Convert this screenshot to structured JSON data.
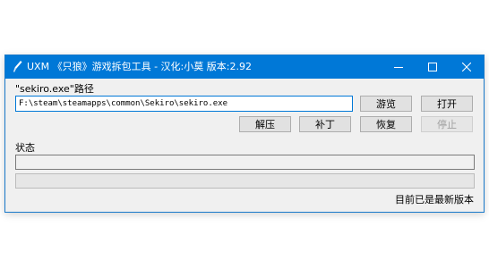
{
  "window": {
    "title": "UXM 《只狼》游戏拆包工具 - 汉化:小莫 版本:2.92"
  },
  "path_section": {
    "label": "\"sekiro.exe\"路径",
    "value": "F:\\steam\\steamapps\\common\\Sekiro\\sekiro.exe",
    "browse_label": "游览",
    "open_label": "打开"
  },
  "actions": {
    "unpack_label": "解压",
    "patch_label": "补丁",
    "restore_label": "恢复",
    "stop_label": "停止"
  },
  "status": {
    "label": "状态",
    "message": "",
    "progress": 0
  },
  "footer": {
    "version_status": "目前已是最新版本"
  },
  "colors": {
    "titlebar": "#0078d7",
    "window_bg": "#f0f0f0",
    "focus_border": "#0078d7"
  }
}
